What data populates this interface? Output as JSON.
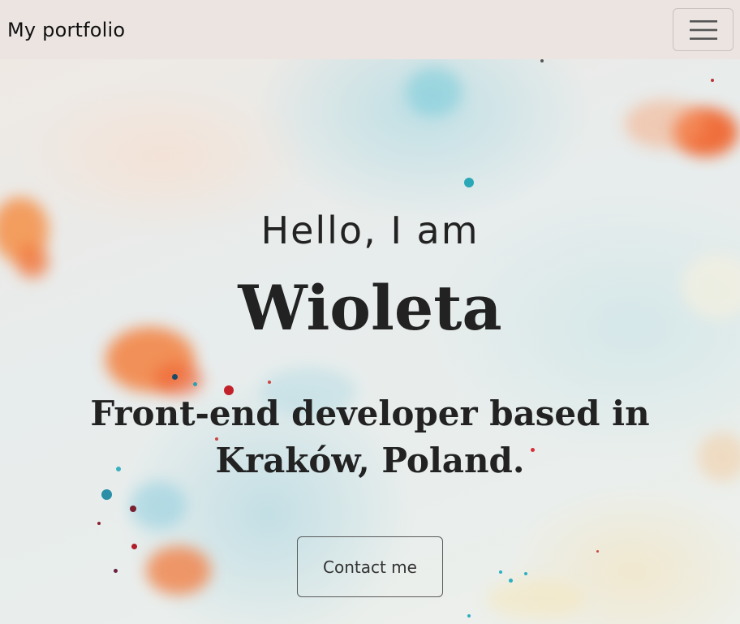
{
  "navbar": {
    "brand": "My portfolio",
    "toggler_icon": "hamburger-menu-icon"
  },
  "hero": {
    "greeting": "Hello, I am",
    "name": "Wioleta",
    "tagline": "Front-end developer based in Kraków, Poland.",
    "contact_button": "Contact me"
  },
  "colors": {
    "navbar_bg": "#ebe4e1",
    "text": "#222222",
    "accent_orange": "#f26a2a",
    "accent_teal": "#5bc2d1"
  }
}
